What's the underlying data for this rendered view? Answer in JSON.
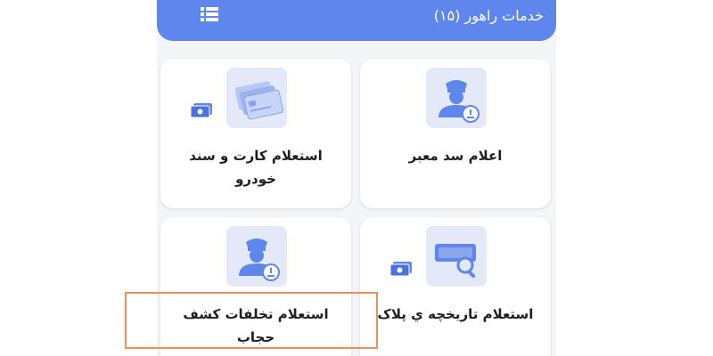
{
  "header": {
    "title": "خدمات راهور (۱۵)",
    "menu_icon": "list-menu-icon"
  },
  "services": [
    {
      "label": "اعلام سد معبر",
      "icon": "police-officer-icon"
    },
    {
      "label_line1": "استعلام کارت و سند",
      "label_line2": "خودرو",
      "icon": "cards-icon",
      "badge_icon": "cash-icon"
    },
    {
      "label": "استعلام تاریخچه ي پلاک",
      "icon": "plate-search-icon",
      "badge_icon": "cash-icon"
    },
    {
      "label_line1": "استعلام تخلفات کشف",
      "label_line2": "حجاب",
      "icon": "police-officer-icon"
    }
  ],
  "colors": {
    "header_bg": "#5f86ec",
    "icon_tile_bg": "#e3e9f9",
    "icon_fg": "#5f86ec",
    "highlight_border": "#ec8f5a",
    "app_bg": "#f4f5f8"
  }
}
